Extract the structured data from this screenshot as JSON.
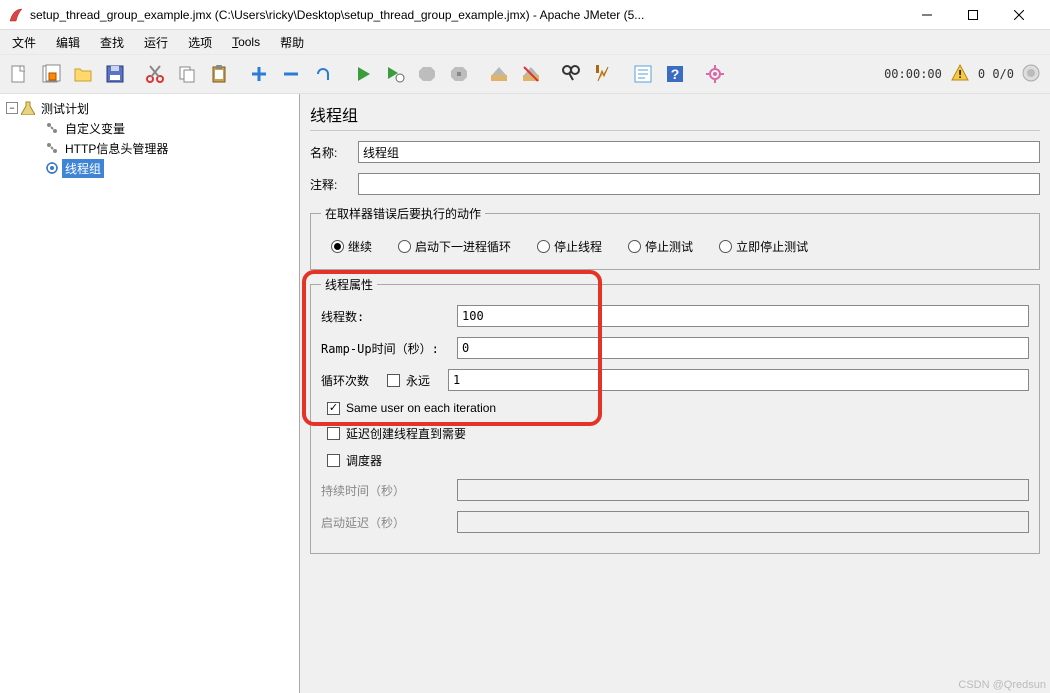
{
  "window": {
    "title": "setup_thread_group_example.jmx (C:\\Users\\ricky\\Desktop\\setup_thread_group_example.jmx) - Apache JMeter (5..."
  },
  "menu": [
    "文件",
    "编辑",
    "查找",
    "运行",
    "选项",
    "Tools",
    "帮助"
  ],
  "status": {
    "time": "00:00:00",
    "counts": "0  0/0"
  },
  "tree": {
    "root": "测试计划",
    "children": [
      "自定义变量",
      "HTTP信息头管理器",
      "线程组"
    ],
    "selected": "线程组"
  },
  "panel": {
    "title": "线程组",
    "name_label": "名称:",
    "name_value": "线程组",
    "comment_label": "注释:",
    "comment_value": ""
  },
  "error_action": {
    "legend": "在取样器错误后要执行的动作",
    "options": [
      "继续",
      "启动下一进程循环",
      "停止线程",
      "停止测试",
      "立即停止测试"
    ],
    "selected": "继续"
  },
  "thread_props": {
    "legend": "线程属性",
    "threads_label": "线程数:",
    "threads_value": "100",
    "ramp_label": "Ramp-Up时间（秒）:",
    "ramp_value": "0",
    "loop_label": "循环次数",
    "forever_label": "永远",
    "loop_value": "1",
    "same_user_label": "Same user on each iteration",
    "delay_create_label": "延迟创建线程直到需要",
    "scheduler_label": "调度器",
    "duration_label": "持续时间（秒）",
    "startup_delay_label": "启动延迟（秒）"
  },
  "watermark": "CSDN @Qredsun"
}
